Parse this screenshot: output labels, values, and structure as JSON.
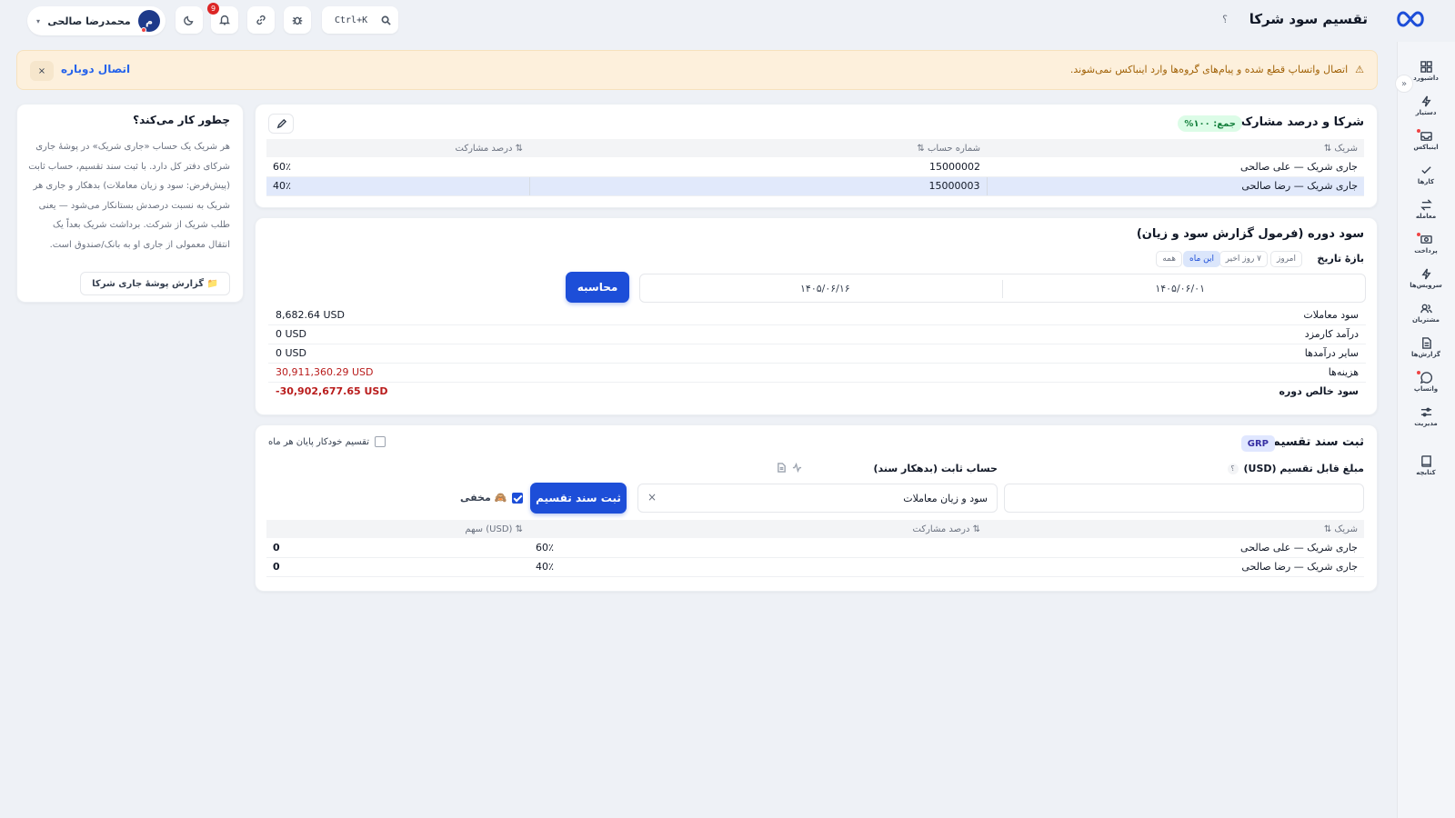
{
  "header": {
    "title": "تقسیم سود شرکا",
    "help": "؟",
    "user_initial": "م",
    "user_name": "محمدرضا صالحی",
    "notification_count": "9",
    "search_shortcut": "Ctrl+K"
  },
  "sidebar": {
    "collapse": "»",
    "items": [
      {
        "label": "داشبورد",
        "icon": "grid-icon"
      },
      {
        "label": "دستیار",
        "icon": "bolt-icon"
      },
      {
        "label": "اینباکس",
        "icon": "inbox-icon"
      },
      {
        "label": "کارها",
        "icon": "check-icon"
      },
      {
        "label": "معامله",
        "icon": "swap-icon"
      },
      {
        "label": "پرداخت",
        "icon": "cash-icon"
      },
      {
        "label": "سرویس‌ها",
        "icon": "bolt-icon"
      },
      {
        "label": "مشتریان",
        "icon": "users-icon"
      },
      {
        "label": "گزارش‌ها",
        "icon": "report-icon"
      },
      {
        "label": "واتساپ",
        "icon": "chat-icon"
      },
      {
        "label": "مدیریت",
        "icon": "sliders-icon"
      },
      {
        "label": "کتابچه",
        "icon": "book-icon"
      }
    ]
  },
  "alert": {
    "message": "اتصال واتساپ قطع شده و پیام‌های گروه‌ها وارد اینباکس نمی‌شوند.",
    "action": "اتصال دوباره",
    "close": "×"
  },
  "how_it_works": {
    "title": "چطور کار می‌کند؟",
    "body": "هر شریک یک حساب «جاری شریک» در پوشهٔ جاری شرکای دفتر کل دارد. با ثبت سند تقسیم، حساب ثابت (پیش‌فرض: سود و زیان معاملات) بدهکار و جاری هر شریک به نسبت درصدش بستانکار می‌شود — یعنی طلب شریک از شرکت. برداشت شریک بعداً یک انتقال معمولی از جاری او به بانک/صندوق است.",
    "report_button": "📁 گزارش پوشهٔ جاری شرکا"
  },
  "partners": {
    "title": "شرکا و درصد مشارکت",
    "total_badge": "جمع: ۱۰۰%",
    "columns": [
      "شریک ⇅",
      "شماره حساب ⇅",
      "⇅ درصد مشارکت"
    ],
    "rows": [
      {
        "name": "جاری شریک — علی صالحی",
        "account": "15000002",
        "percent": "60٪"
      },
      {
        "name": "جاری شریک — رضا صالحی",
        "account": "15000003",
        "percent": "40٪"
      }
    ]
  },
  "profit": {
    "title": "سود دوره (فرمول گزارش سود و زیان)",
    "range_label": "بازهٔ تاریخ",
    "range_chips": [
      "امروز",
      "۷ روز اخیر",
      "این ماه",
      "همه"
    ],
    "active_chip": "این ماه",
    "date_from": "۱۴۰۵/۰۶/۰۱",
    "date_to": "۱۴۰۵/۰۶/۱۶",
    "calculate_button": "محاسبه",
    "rows": [
      {
        "label": "سود معاملات",
        "value": "8,682.64 USD",
        "negative": false
      },
      {
        "label": "درآمد کارمزد",
        "value": "0 USD",
        "negative": false
      },
      {
        "label": "سایر درآمدها",
        "value": "0 USD",
        "negative": false
      },
      {
        "label": "هزینه‌ها",
        "value": "30,911,360.29 USD",
        "negative": true
      },
      {
        "label": "سود خالص دوره",
        "value": "-30,902,677.65 USD",
        "negative": true
      }
    ]
  },
  "allocation": {
    "title": "ثبت سند تقسیم",
    "badge": "GRP",
    "auto_label": "تقسیم خودکار پایان هر ماه",
    "amount_label": "مبلغ قابل تقسیم (USD)",
    "amount_help": "؟",
    "amount_value": "",
    "fixed_account_label": "حساب ثابت (بدهکار سند)",
    "fixed_account_value": "سود و زیان معاملات",
    "clear": "×",
    "submit_button": "ثبت سند تقسیم",
    "hidden_label": "🙈 مخفی",
    "columns": [
      "شریک ⇅",
      "⇅ درصد مشارکت",
      "⇅ (USD) سهم"
    ],
    "rows": [
      {
        "name": "جاری شریک — علی صالحی",
        "percent": "60٪",
        "share": "0"
      },
      {
        "name": "جاری شریک — رضا صالحی",
        "percent": "40٪",
        "share": "0"
      }
    ]
  },
  "colors": {
    "primary": "#1d4ed8",
    "negative": "#b91c1c",
    "alert_bg": "#fdf0dc",
    "alert_text": "#a16207"
  }
}
